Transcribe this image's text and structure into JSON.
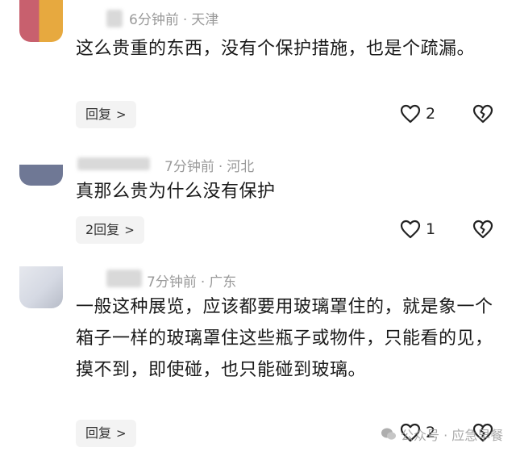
{
  "comments": [
    {
      "time": "6分钟前",
      "location": "天津",
      "text": "这么贵重的东西，没有个保护措施，也是个疏漏。",
      "reply_label": "回复",
      "likes": "2"
    },
    {
      "time": "7分钟前",
      "location": "河北",
      "text": "真那么贵为什么没有保护",
      "reply_label": "2回复",
      "likes": "1"
    },
    {
      "time": "7分钟前",
      "location": "广东",
      "text": "一般这种展览，应该都要用玻璃罩住的，就是象一个箱子一样的玻璃罩住这些瓶子或物件，只能看的见，摸不到，即使碰，也只能碰到玻璃。",
      "reply_label": "回复",
      "likes": "2"
    }
  ],
  "watermark": "公众号 · 应急早餐"
}
